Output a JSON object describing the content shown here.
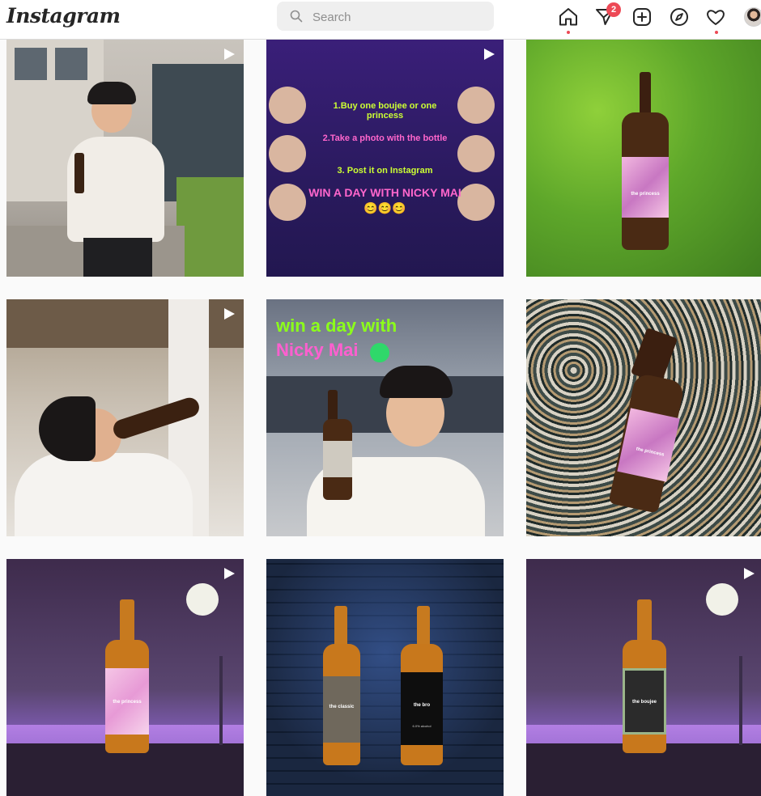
{
  "app": {
    "logo": "Instagram"
  },
  "search": {
    "placeholder": "Search",
    "value": ""
  },
  "nav": {
    "icons": [
      "home-icon",
      "direct-message-icon",
      "new-post-icon",
      "explore-icon",
      "activity-heart-icon",
      "profile-avatar"
    ],
    "messages_badge": "2"
  },
  "colors": {
    "accent": "#ed4956",
    "text": "#262626",
    "border": "#dbdbdb"
  },
  "posts": [
    {
      "kind": "photo",
      "reel": true
    },
    {
      "kind": "promo",
      "reel": true,
      "lines": [
        "1.Buy one boujee or one princess",
        "2.Take a photo with the bottle",
        "3. Post it on Instagram"
      ],
      "headline": "WIN A DAY WITH NICKY MAI 😊😊😊"
    },
    {
      "kind": "bottle-grass",
      "reel": false,
      "label": "the princess"
    },
    {
      "kind": "photo",
      "reel": true
    },
    {
      "kind": "promo-photo",
      "reel": false,
      "line1": "win a day with",
      "line2": "Nicky Mai"
    },
    {
      "kind": "bottle-stones",
      "reel": false,
      "label": "the princess"
    },
    {
      "kind": "night",
      "reel": true,
      "label": "the princess"
    },
    {
      "kind": "bricks",
      "reel": false,
      "label_left": "the classic",
      "label_right": "the bro",
      "sublabel_right": "6.0% alcohol"
    },
    {
      "kind": "night",
      "reel": true,
      "label": "the boujee"
    }
  ]
}
